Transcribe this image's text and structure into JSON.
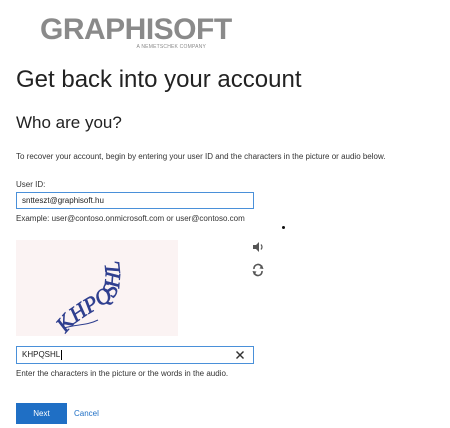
{
  "brand": {
    "name": "GRAPHISOFT",
    "tagline": "A NEMETSCHEK COMPANY",
    "color": "#8a8a8a"
  },
  "page": {
    "title": "Get back into your account",
    "subtitle": "Who are you?",
    "intro": "To recover your account, begin by entering your user ID and the characters in the picture or audio below."
  },
  "user_id": {
    "label": "User ID:",
    "value": "sntteszt@graphisoft.hu",
    "example": "Example: user@contoso.onmicrosoft.com or user@contoso.com"
  },
  "captcha": {
    "image_text": "KHPQSHL",
    "audio_icon": "speaker-icon",
    "refresh_icon": "refresh-icon",
    "input_value": "KHPQSHL",
    "hint": "Enter the characters in the picture or the words in the audio."
  },
  "actions": {
    "next_label": "Next",
    "cancel_label": "Cancel",
    "accent": "#1f6fc5"
  }
}
